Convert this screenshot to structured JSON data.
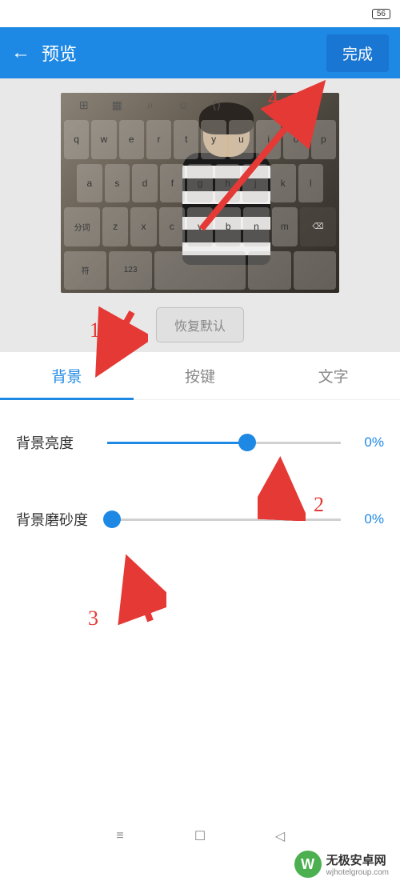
{
  "status": {
    "battery": "56"
  },
  "header": {
    "title": "预览",
    "done": "完成"
  },
  "keyboard": {
    "tools": [
      "⊞",
      "▦",
      "⌕",
      "☺",
      "⟨⟩",
      "⊙",
      "⋯",
      "⌄"
    ],
    "row1": [
      "q",
      "w",
      "e",
      "r",
      "t",
      "y",
      "u",
      "i",
      "o",
      "p"
    ],
    "row2": [
      "a",
      "s",
      "d",
      "f",
      "g",
      "h",
      "j",
      "k",
      "l"
    ],
    "row3_left": "分词",
    "row3": [
      "z",
      "x",
      "c",
      "v",
      "b",
      "n",
      "m"
    ],
    "row3_right": "⌫",
    "row4": [
      "符",
      "123",
      "",
      "",
      "",
      ""
    ]
  },
  "restore": "恢复默认",
  "tabs": {
    "bg": "背景",
    "keys": "按键",
    "text": "文字"
  },
  "sliders": {
    "brightness": {
      "label": "背景亮度",
      "value": "0%",
      "position": 60
    },
    "blur": {
      "label": "背景磨砂度",
      "value": "0%",
      "position": 2
    }
  },
  "annotations": {
    "n1": "1",
    "n2": "2",
    "n3": "3",
    "n4": "4"
  },
  "watermark": {
    "title": "无极安卓网",
    "url": "wjhotelgroup.com"
  }
}
